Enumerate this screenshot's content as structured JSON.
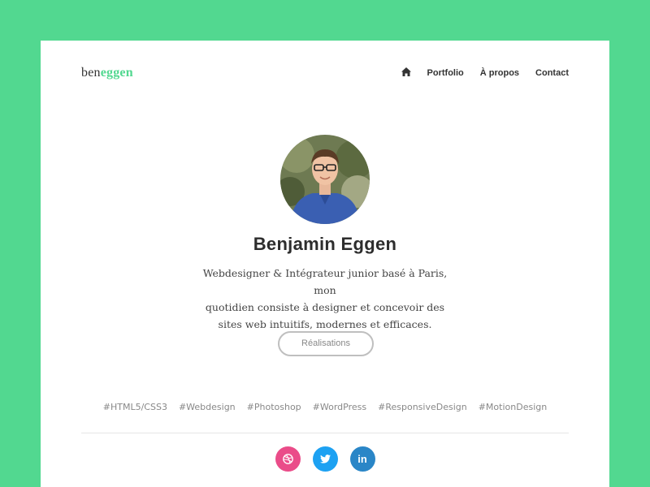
{
  "brand": {
    "part1": "ben",
    "part2": "eggen",
    "accent_color": "#52d890"
  },
  "nav": {
    "home_icon": "home-icon",
    "items": [
      {
        "label": "Portfolio"
      },
      {
        "label": "À propos"
      },
      {
        "label": "Contact"
      }
    ]
  },
  "profile": {
    "avatar_icon": "profile-photo",
    "name": "Benjamin Eggen",
    "bio_lines": [
      "Webdesigner & Intégrateur junior basé à Paris, mon",
      "quotidien consiste à designer et concevoir des",
      "sites web intuitifs, modernes et efficaces."
    ]
  },
  "cta": {
    "label": "Réalisations"
  },
  "tags": [
    "#HTML5/CSS3",
    "#Webdesign",
    "#Photoshop",
    "#WordPress",
    "#ResponsiveDesign",
    "#MotionDesign"
  ],
  "social": [
    {
      "icon": "dribbble-icon",
      "color": "#ea4c89"
    },
    {
      "icon": "twitter-icon",
      "color": "#1da1f2"
    },
    {
      "icon": "linkedin-icon",
      "color": "#2a86c7",
      "glyph": "in"
    }
  ],
  "colors": {
    "background": "#52d890",
    "card": "#ffffff"
  }
}
